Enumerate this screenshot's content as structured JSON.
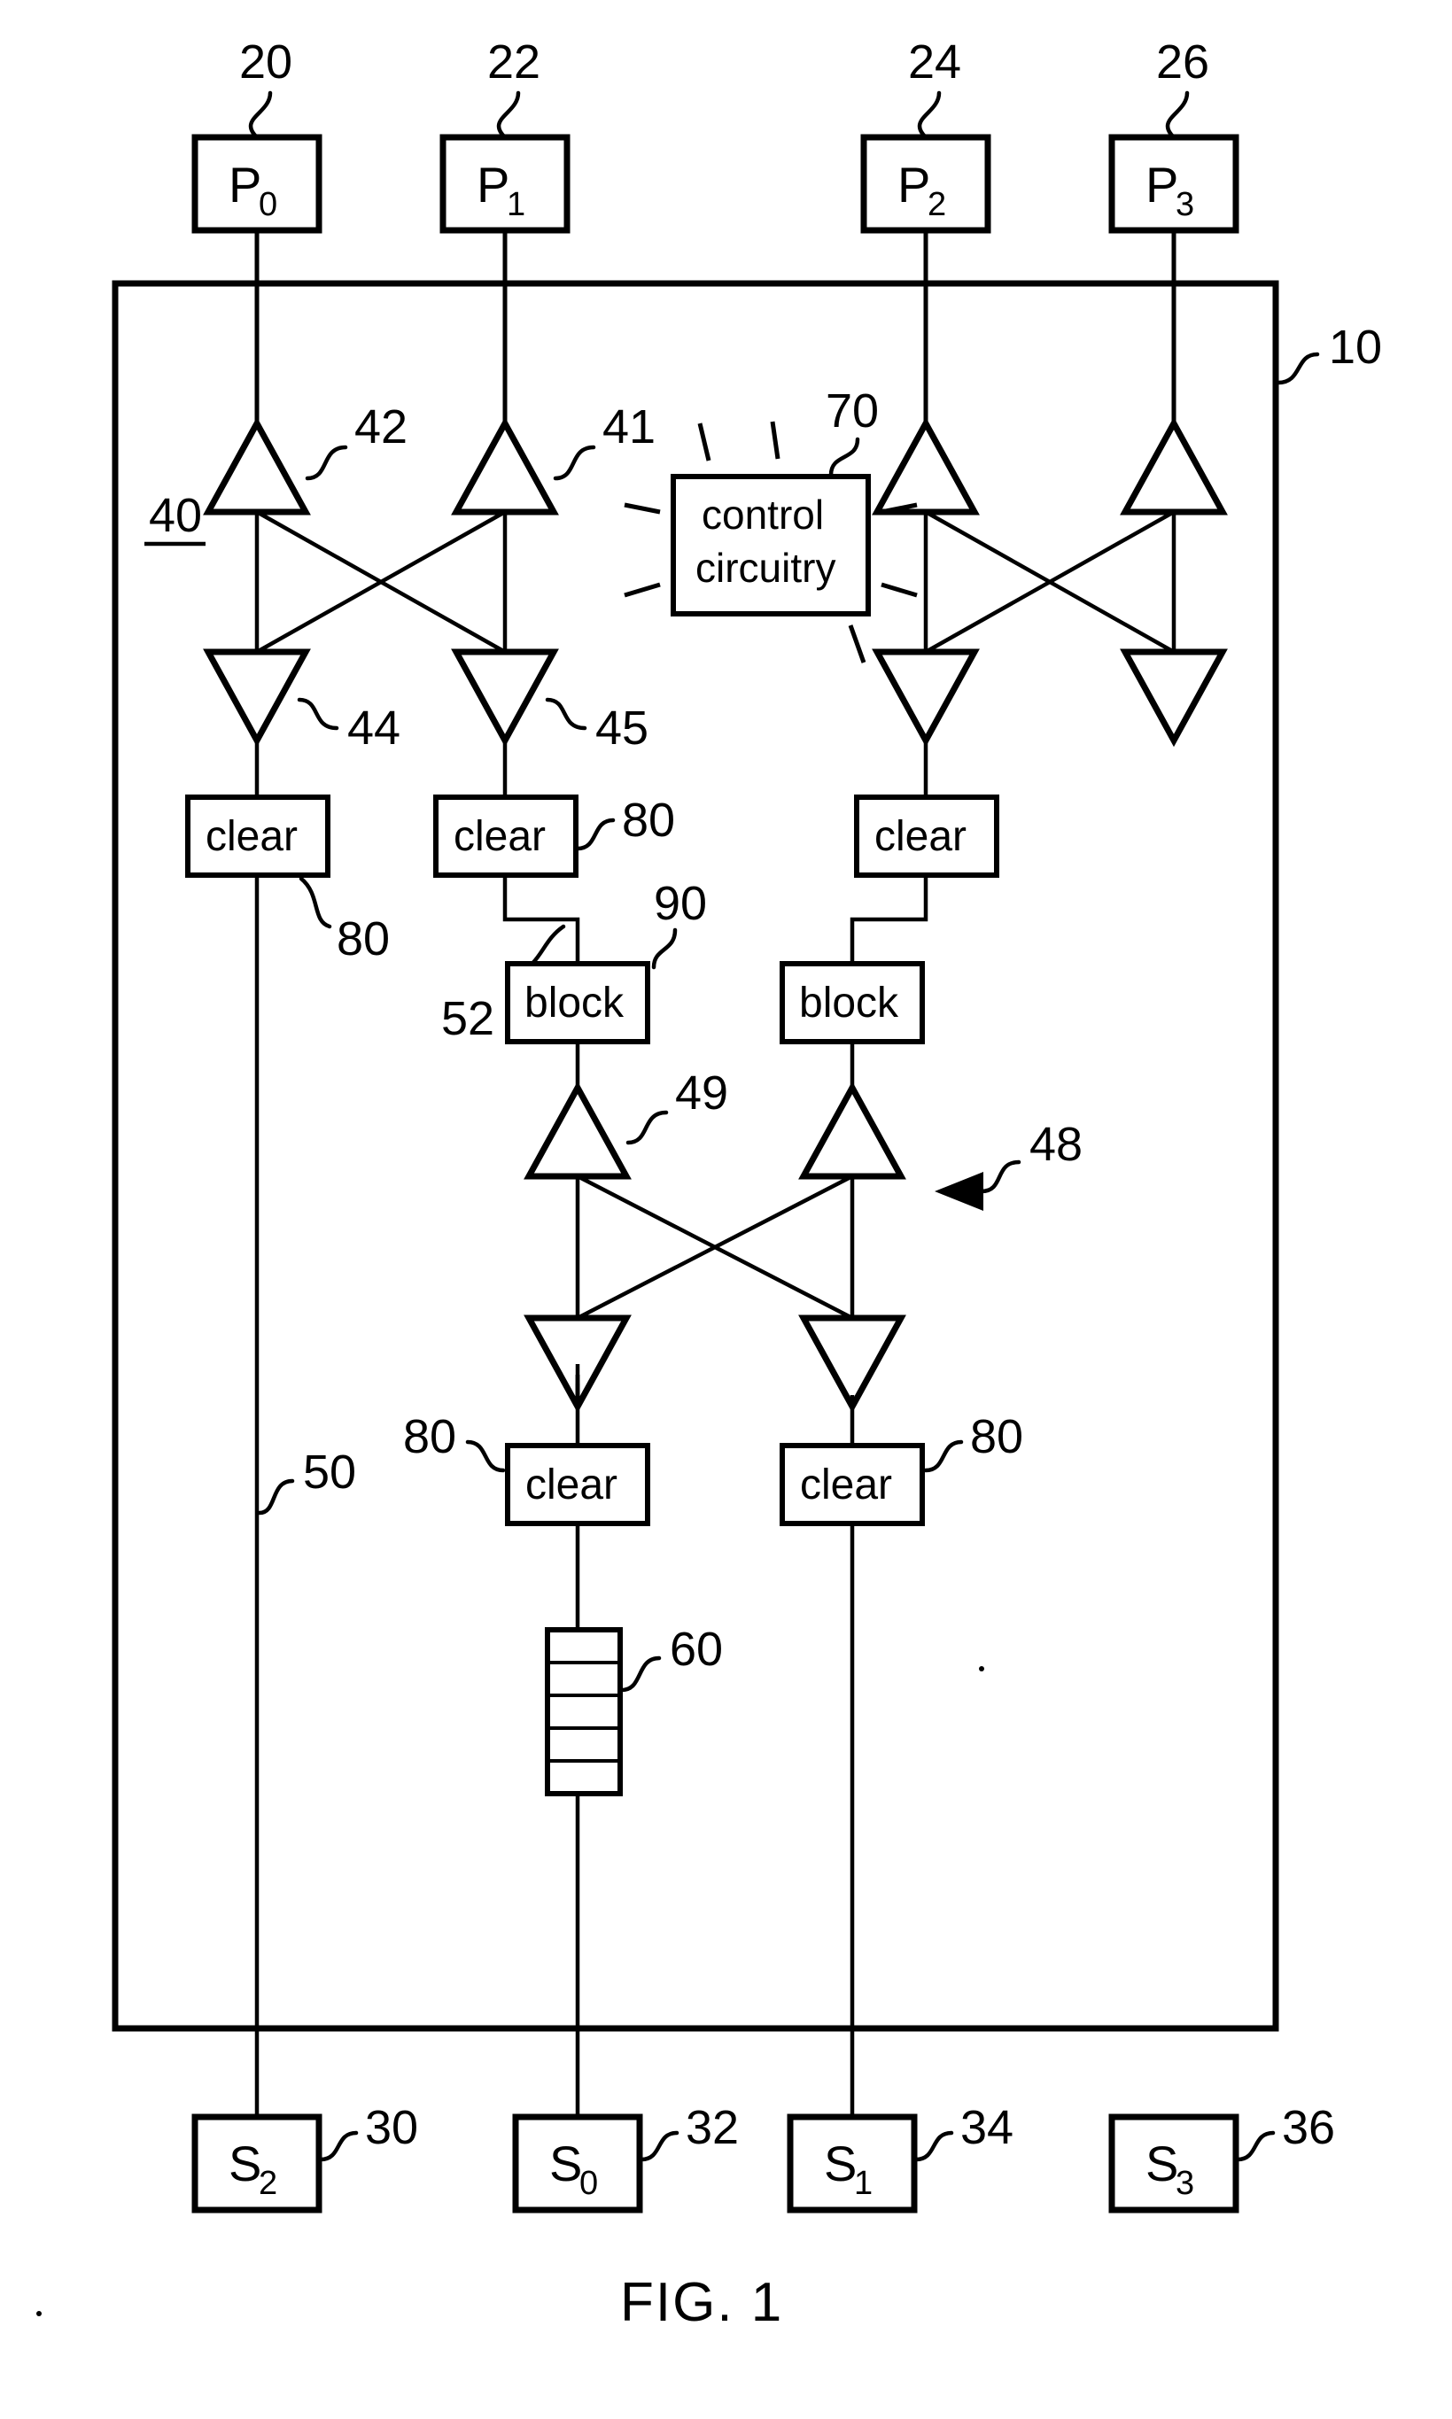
{
  "figure": {
    "caption": "FIG. 1",
    "system_ref": "10",
    "switch_fabric_ref": "40",
    "second_stage_ref": "48",
    "link_ref": "50",
    "link_ref_52": "52",
    "buffer_ref": "60",
    "control_ref": "70",
    "clear_ref": "80",
    "block_ref": "90"
  },
  "processors": [
    {
      "label": "P",
      "sub": "0",
      "ref": "20"
    },
    {
      "label": "P",
      "sub": "1",
      "ref": "22"
    },
    {
      "label": "P",
      "sub": "2",
      "ref": "24"
    },
    {
      "label": "P",
      "sub": "3",
      "ref": "26"
    }
  ],
  "storage": [
    {
      "label": "S",
      "sub": "2",
      "ref": "30"
    },
    {
      "label": "S",
      "sub": "0",
      "ref": "32"
    },
    {
      "label": "S",
      "sub": "1",
      "ref": "34"
    },
    {
      "label": "S",
      "sub": "3",
      "ref": "36"
    }
  ],
  "control_box": {
    "line1": "control",
    "line2": "circuitry",
    "ref": "70"
  },
  "stage1_up_switches": [
    {
      "ref": "42"
    },
    {
      "ref": "41"
    },
    {
      "ref": ""
    },
    {
      "ref": ""
    }
  ],
  "stage1_down_switches": [
    {
      "ref": "44"
    },
    {
      "ref": "45"
    },
    {
      "ref": ""
    },
    {
      "ref": ""
    }
  ],
  "stage2_up_switches": [
    {
      "ref": "49"
    },
    {
      "ref": ""
    }
  ],
  "stage2_down_switches": [
    {
      "ref": ""
    },
    {
      "ref": ""
    }
  ],
  "clear_boxes": [
    {
      "label": "clear",
      "ref": "80"
    },
    {
      "label": "clear",
      "ref": "80"
    },
    {
      "label": "clear",
      "ref": ""
    },
    {
      "label": "clear",
      "ref": "80"
    },
    {
      "label": "clear",
      "ref": "80"
    }
  ],
  "block_boxes": [
    {
      "label": "block",
      "ref": "90"
    },
    {
      "label": "block",
      "ref": ""
    }
  ],
  "buffer": {
    "ref": "60",
    "cells": 5
  }
}
